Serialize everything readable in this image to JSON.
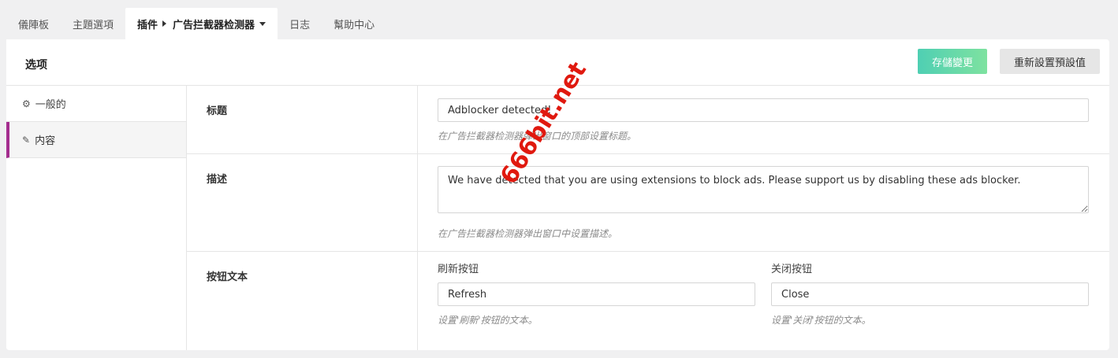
{
  "tabs": [
    {
      "label": "儀陣板"
    },
    {
      "label": "主題選項"
    },
    {
      "label": "插件",
      "sub": "广告拦截器检测器"
    },
    {
      "label": "日志"
    },
    {
      "label": "幫助中心"
    }
  ],
  "header": {
    "title": "选项",
    "save_label": "存儲變更",
    "reset_label": "重新設置預設值"
  },
  "sidebar": {
    "items": [
      {
        "label": "一般的",
        "icon": "gear-icon"
      },
      {
        "label": "内容",
        "icon": "edit-icon"
      }
    ]
  },
  "fields": {
    "title": {
      "label": "标题",
      "value": "Adblocker detected!",
      "help": "在广告拦截器检测器弹出窗口的顶部设置标题。"
    },
    "description": {
      "label": "描述",
      "value": "We have detected that you are using extensions to block ads. Please support us by disabling these ads blocker.",
      "help": "在广告拦截器检测器弹出窗口中设置描述。"
    },
    "buttons": {
      "label": "按钮文本",
      "refresh": {
        "label": "刷新按钮",
        "value": "Refresh",
        "help": "设置'刷新'按钮的文本。"
      },
      "close": {
        "label": "关闭按钮",
        "value": "Close",
        "help": "设置'关闭'按钮的文本。"
      }
    }
  },
  "watermark": "666bit.net",
  "colors": {
    "accent": "#a42d8e",
    "save_start": "#4fcfb3",
    "save_end": "#7ee2a0",
    "watermark": "#e0190f"
  }
}
